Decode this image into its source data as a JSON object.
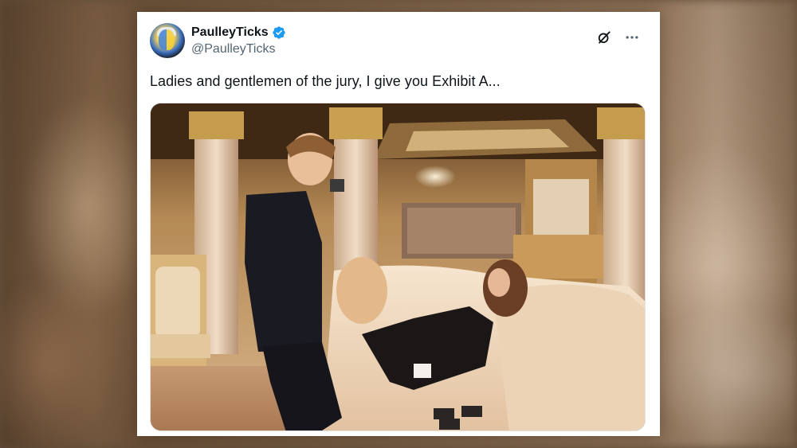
{
  "tweet": {
    "display_name": "PaulleyTicks",
    "handle": "@PaulleyTicks",
    "verified": true,
    "text": "Ladies and gentlemen of the jury, I give you Exhibit A..."
  },
  "icons": {
    "verified": "verified-badge-icon",
    "grok": "grok-icon",
    "more": "more-options-icon"
  },
  "colors": {
    "verified_blue": "#1d9bf0",
    "text_primary": "#0f1419",
    "text_secondary": "#536471"
  }
}
